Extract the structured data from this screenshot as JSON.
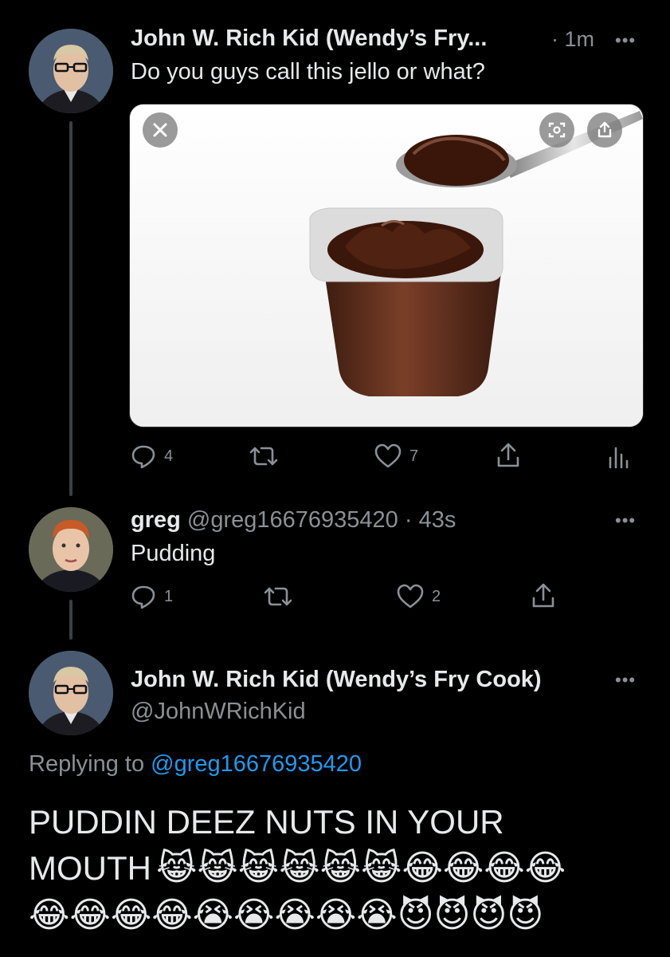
{
  "tweet1": {
    "display_name": "John W. Rich Kid (Wendy’s Fry...",
    "time": "· 1m",
    "text": "Do you guys call this jello or what?",
    "more": "•••",
    "actions": {
      "replies": "4",
      "likes": "7"
    }
  },
  "tweet2": {
    "display_name": "greg",
    "handle": "@greg16676935420",
    "time": "· 43s",
    "text": "Pudding",
    "more": "•••",
    "actions": {
      "replies": "1",
      "likes": "2"
    }
  },
  "tweet3": {
    "display_name": "John W. Rich Kid (Wendy’s Fry Cook)",
    "handle": "@JohnWRichKid",
    "more": "•••",
    "replying_prefix": "Replying to",
    "replying_handle": "@greg16676935420",
    "text_line1": "PUDDIN DEEZ NUTS IN YOUR",
    "text_line2": "MOUTH",
    "emoji_line1": "😹😹😹😹😹😹😂😂😂😂",
    "emoji_line2": "😂😂😂😂😭😭😭😭😭😈😈😈😈"
  },
  "colors": {
    "background": "#000000",
    "text": "#e7e9ea",
    "muted": "#8b9096",
    "link": "#1d9bf0"
  },
  "icons": [
    "reply-icon",
    "retweet-icon",
    "like-icon",
    "share-icon",
    "analytics-icon",
    "close-icon",
    "screenshot-icon"
  ]
}
